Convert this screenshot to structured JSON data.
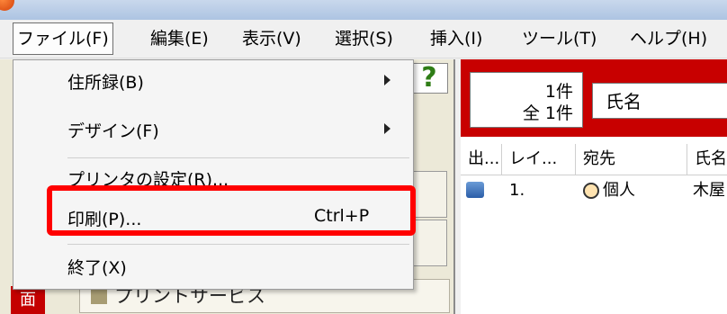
{
  "menubar": {
    "items": [
      "ファイル(F)",
      "編集(E)",
      "表示(V)",
      "選択(S)",
      "挿入(I)",
      "ツール(T)",
      "ヘルプ(H)"
    ]
  },
  "file_menu": {
    "address_book": "住所録(B)",
    "design": "デザイン(F)",
    "printer_settings": "プリンタの設定(R)...",
    "print": "印刷(P)...",
    "print_shortcut": "Ctrl+P",
    "exit": "終了(X)"
  },
  "background": {
    "help_symbol": "?",
    "bottom_label": "面",
    "print_service": "プリントサービス"
  },
  "records": {
    "count_line1": "1件",
    "count_line2": "全 1件",
    "field_label": "氏名",
    "columns": [
      "出...",
      "レイ...",
      "宛先",
      "氏名"
    ],
    "row": {
      "number": "1.",
      "recipient": "個人",
      "name": "木屋"
    }
  },
  "colors": {
    "highlight": "#ff0000",
    "header_red": "#c80000"
  }
}
